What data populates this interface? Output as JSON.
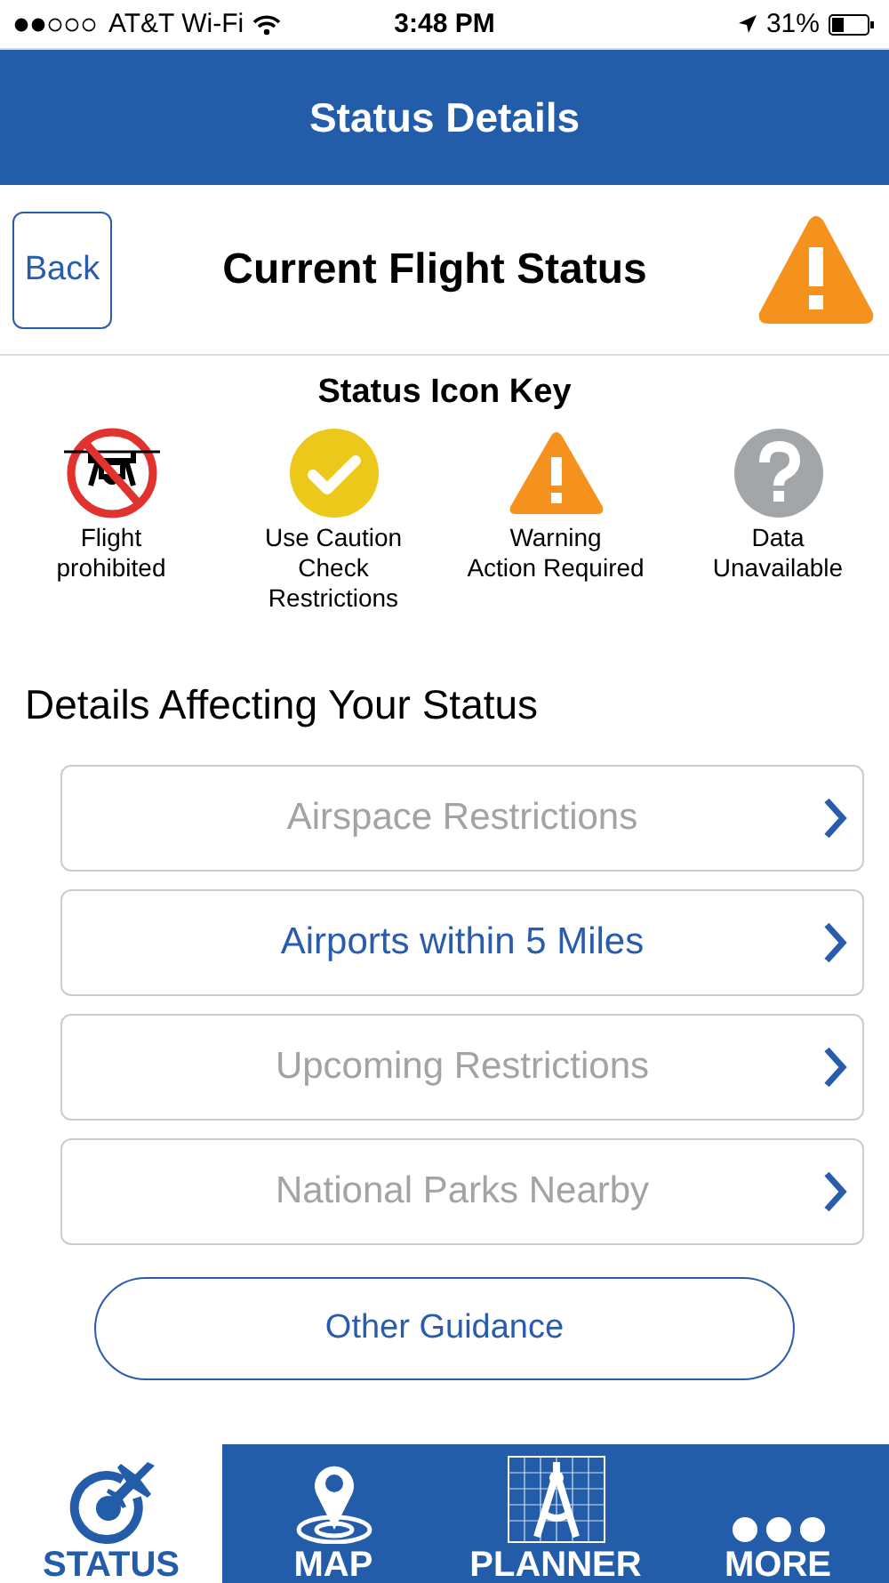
{
  "status_bar": {
    "carrier": "AT&T Wi-Fi",
    "time": "3:48 PM",
    "battery": "31%"
  },
  "header": {
    "title": "Status Details"
  },
  "flight_status": {
    "back": "Back",
    "title": "Current Flight Status",
    "kind": "warning"
  },
  "icon_key": {
    "title": "Status Icon Key",
    "items": [
      {
        "kind": "prohibited",
        "lines": [
          "Flight",
          "prohibited"
        ]
      },
      {
        "kind": "caution",
        "lines": [
          "Use Caution",
          "Check",
          "Restrictions"
        ]
      },
      {
        "kind": "warning",
        "lines": [
          "Warning",
          "Action Required"
        ]
      },
      {
        "kind": "unavailable",
        "lines": [
          "Data",
          "Unavailable"
        ]
      }
    ]
  },
  "details": {
    "title": "Details Affecting Your Status",
    "items": [
      {
        "label": "Airspace Restrictions",
        "disabled": true
      },
      {
        "label": "Airports within 5 Miles",
        "disabled": false
      },
      {
        "label": "Upcoming Restrictions",
        "disabled": true
      },
      {
        "label": "National Parks Nearby",
        "disabled": true
      }
    ]
  },
  "other_button": "Other Guidance",
  "tabs": [
    {
      "kind": "status",
      "label": "STATUS",
      "selected": true
    },
    {
      "kind": "map",
      "label": "MAP",
      "selected": false
    },
    {
      "kind": "planner",
      "label": "PLANNER",
      "selected": false
    },
    {
      "kind": "more",
      "label": "MORE",
      "selected": false
    }
  ]
}
